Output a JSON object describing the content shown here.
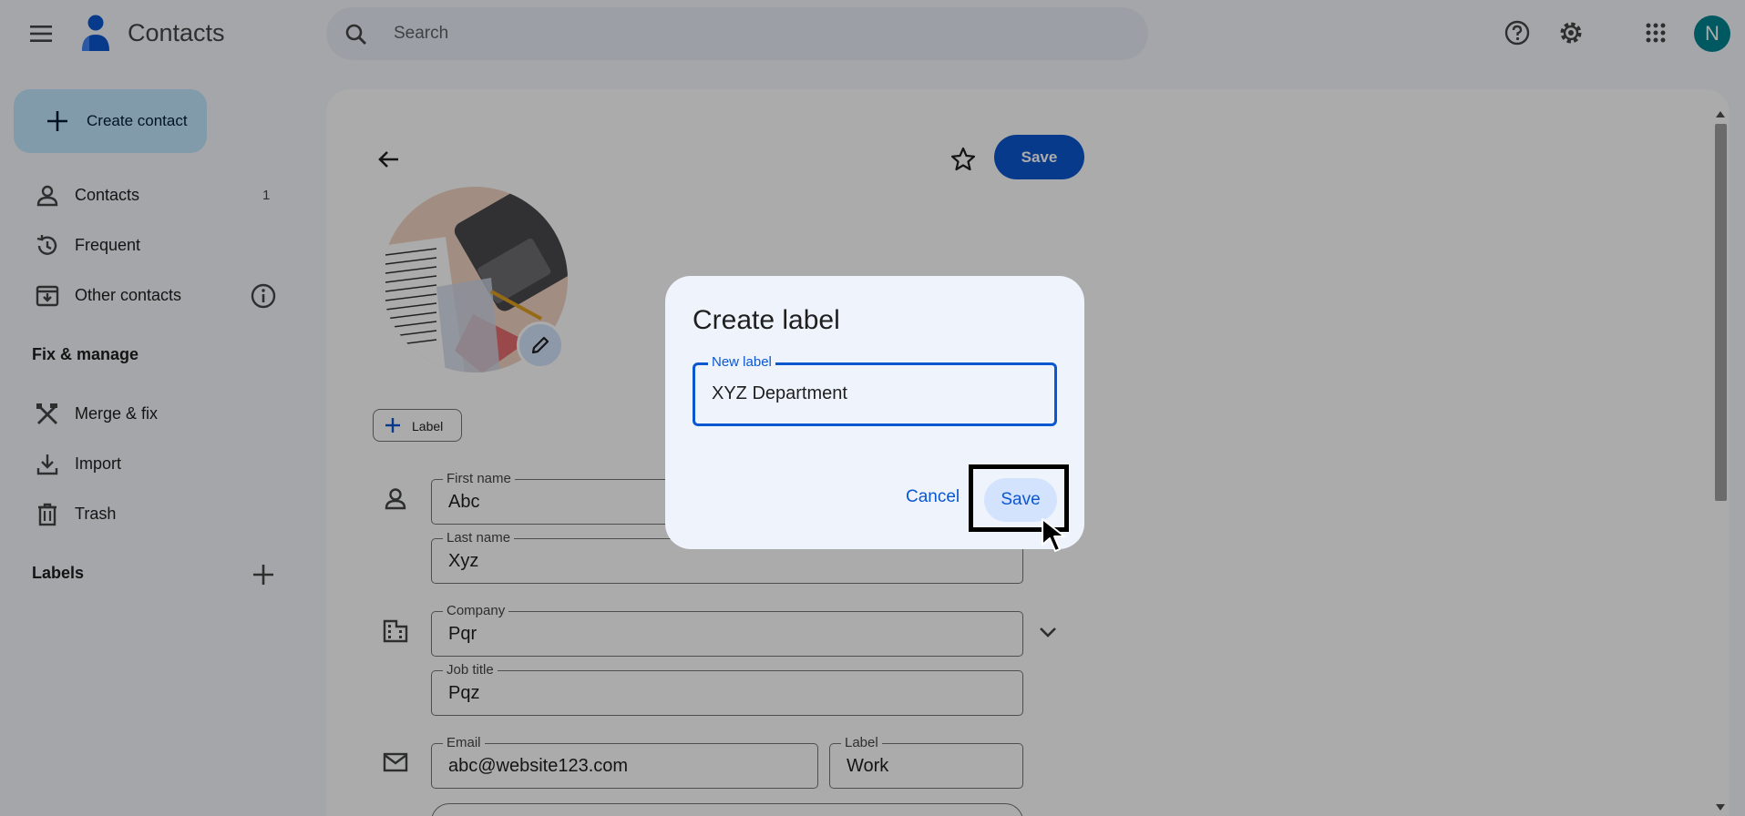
{
  "app": {
    "title": "Contacts",
    "avatar_initial": "N"
  },
  "search": {
    "placeholder": "Search"
  },
  "sidebar": {
    "create_label": "Create contact",
    "items": [
      {
        "label": "Contacts",
        "count": "1"
      },
      {
        "label": "Frequent"
      },
      {
        "label": "Other contacts"
      }
    ],
    "fix_manage_heading": "Fix & manage",
    "fix_items": [
      {
        "label": "Merge & fix"
      },
      {
        "label": "Import"
      },
      {
        "label": "Trash"
      }
    ],
    "labels_heading": "Labels"
  },
  "editor": {
    "save_label": "Save",
    "label_chip": "Label",
    "fields": {
      "first_name": {
        "label": "First name",
        "value": "Abc"
      },
      "last_name": {
        "label": "Last name",
        "value": "Xyz"
      },
      "company": {
        "label": "Company",
        "value": "Pqr"
      },
      "job_title": {
        "label": "Job title",
        "value": "Pqz"
      },
      "email": {
        "label": "Email",
        "value": "abc@website123.com"
      },
      "email_label": {
        "label": "Label",
        "value": "Work"
      }
    }
  },
  "dialog": {
    "title": "Create label",
    "field_label": "New label",
    "field_value": "XYZ Department",
    "cancel_label": "Cancel",
    "save_label": "Save"
  },
  "colors": {
    "primary": "#0b57d0",
    "create_button": "#c2e7ff",
    "avatar": "#00838f"
  },
  "icons": [
    "menu-icon",
    "contacts-logo",
    "search-icon",
    "help-icon",
    "gear-icon",
    "apps-grid-icon",
    "plus-icon",
    "person-icon",
    "history-icon",
    "archive-icon",
    "info-icon",
    "merge-fix-icon",
    "download-icon",
    "trash-icon",
    "back-arrow-icon",
    "star-icon",
    "pencil-icon",
    "building-icon",
    "mail-icon",
    "chevron-down-icon",
    "cursor-arrow-icon"
  ]
}
